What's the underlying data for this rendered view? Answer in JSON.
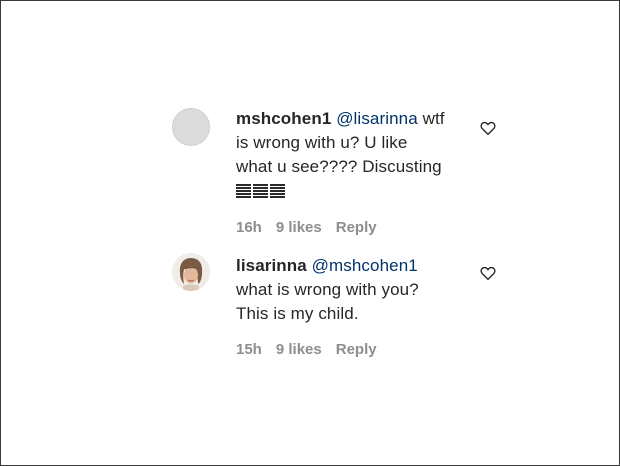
{
  "comments": [
    {
      "username": "mshcohen1",
      "mention": "@lisarinna",
      "text_lines": [
        "wtf",
        "is wrong with u? U like",
        "what u see???? Discusting"
      ],
      "emoji_count": 3,
      "time": "16h",
      "likes": "9 likes",
      "reply": "Reply"
    },
    {
      "username": "lisarinna",
      "mention": "@mshcohen1",
      "text_lines": [
        "what is wrong with you?",
        "This is my child."
      ],
      "time": "15h",
      "likes": "9 likes",
      "reply": "Reply"
    }
  ],
  "colors": {
    "text": "#262626",
    "mention": "#003569",
    "meta": "#8e8e8e"
  },
  "icons": [
    "avatar-default",
    "avatar-photo",
    "heart-outline-icon"
  ]
}
